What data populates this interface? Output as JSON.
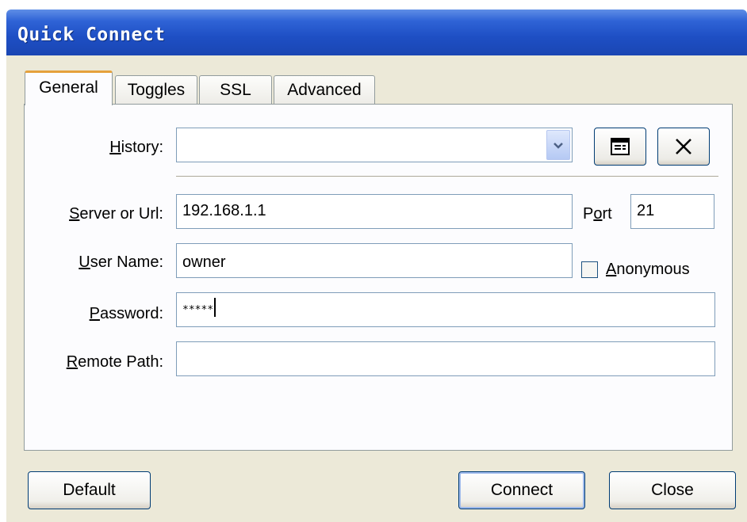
{
  "window": {
    "title": "Quick Connect"
  },
  "tabs": [
    {
      "label": "General",
      "active": true
    },
    {
      "label": "Toggles",
      "active": false
    },
    {
      "label": "SSL",
      "active": false
    },
    {
      "label": "Advanced",
      "active": false
    }
  ],
  "form": {
    "history": {
      "label_underlined": "H",
      "label_rest": "istory:",
      "value": ""
    },
    "server": {
      "label_underlined": "S",
      "label_rest": "erver or Url:",
      "value": "192.168.1.1"
    },
    "port": {
      "label_pre": "P",
      "label_underlined": "o",
      "label_rest": "rt",
      "value": "21"
    },
    "username": {
      "label_underlined": "U",
      "label_rest": "ser Name:",
      "value": "owner"
    },
    "anonymous": {
      "label_underlined": "A",
      "label_rest": "nonymous",
      "checked": false
    },
    "password": {
      "label_underlined": "P",
      "label_rest": "assword:",
      "value": "*****"
    },
    "remote_path": {
      "label_underlined": "R",
      "label_rest": "emote Path:",
      "value": ""
    }
  },
  "icons": {
    "history_manage": "list-window-icon",
    "history_clear": "close-x-icon",
    "dropdown": "chevron-down-icon"
  },
  "buttons": {
    "default": "Default",
    "connect": "Connect",
    "close": "Close"
  }
}
